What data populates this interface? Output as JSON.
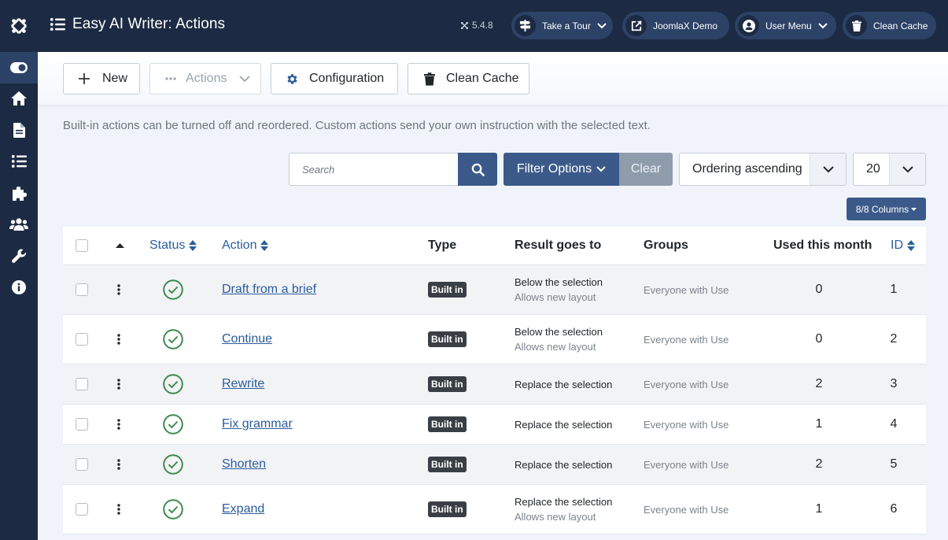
{
  "header": {
    "title": "Easy AI Writer: Actions",
    "version": "5.4.8",
    "buttons": [
      {
        "label": "Take a Tour",
        "icon": "signpost-icon",
        "has_dropdown": true
      },
      {
        "label": "JoomlaX Demo",
        "icon": "external-link-icon",
        "has_dropdown": false
      },
      {
        "label": "User Menu",
        "icon": "user-icon",
        "has_dropdown": true
      },
      {
        "label": "Clean Cache",
        "icon": "trash-icon",
        "has_dropdown": false
      }
    ]
  },
  "sidebar": {
    "items": [
      {
        "icon": "toggle-icon",
        "active": true
      },
      {
        "icon": "home-icon"
      },
      {
        "icon": "document-icon"
      },
      {
        "icon": "list-icon"
      },
      {
        "icon": "puzzle-icon"
      },
      {
        "icon": "users-icon"
      },
      {
        "icon": "wrench-icon"
      },
      {
        "icon": "info-icon"
      }
    ]
  },
  "toolbar": {
    "new_label": "New",
    "actions_label": "Actions",
    "configuration_label": "Configuration",
    "clean_cache_label": "Clean Cache"
  },
  "intro": "Built-in actions can be turned off and reordered. Custom actions send your own instruction with the selected text.",
  "filters": {
    "search_placeholder": "Search",
    "filter_options_label": "Filter Options",
    "clear_label": "Clear",
    "ordering_value": "Ordering ascending",
    "limit_value": "20",
    "columns_label": "8/8 Columns"
  },
  "table": {
    "headers": {
      "status": "Status",
      "action": "Action",
      "type": "Type",
      "result": "Result goes to",
      "groups": "Groups",
      "used": "Used this month",
      "id": "ID"
    },
    "rows": [
      {
        "action": "Draft from a brief",
        "type": "Built in",
        "result": "Below the selection",
        "result_sub": "Allows new layout",
        "groups": "Everyone with Use",
        "used": "0",
        "id": "1"
      },
      {
        "action": "Continue",
        "type": "Built in",
        "result": "Below the selection",
        "result_sub": "Allows new layout",
        "groups": "Everyone with Use",
        "used": "0",
        "id": "2"
      },
      {
        "action": "Rewrite",
        "type": "Built in",
        "result": "Replace the selection",
        "result_sub": "",
        "groups": "Everyone with Use",
        "used": "2",
        "id": "3"
      },
      {
        "action": "Fix grammar",
        "type": "Built in",
        "result": "Replace the selection",
        "result_sub": "",
        "groups": "Everyone with Use",
        "used": "1",
        "id": "4"
      },
      {
        "action": "Shorten",
        "type": "Built in",
        "result": "Replace the selection",
        "result_sub": "",
        "groups": "Everyone with Use",
        "used": "2",
        "id": "5"
      },
      {
        "action": "Expand",
        "type": "Built in",
        "result": "Replace the selection",
        "result_sub": "Allows new layout",
        "groups": "Everyone with Use",
        "used": "1",
        "id": "6"
      }
    ]
  },
  "colors": {
    "header_bg": "#1c2b43",
    "accent": "#3b5a8a",
    "link": "#2a5d9c",
    "success": "#3d8a4f"
  }
}
